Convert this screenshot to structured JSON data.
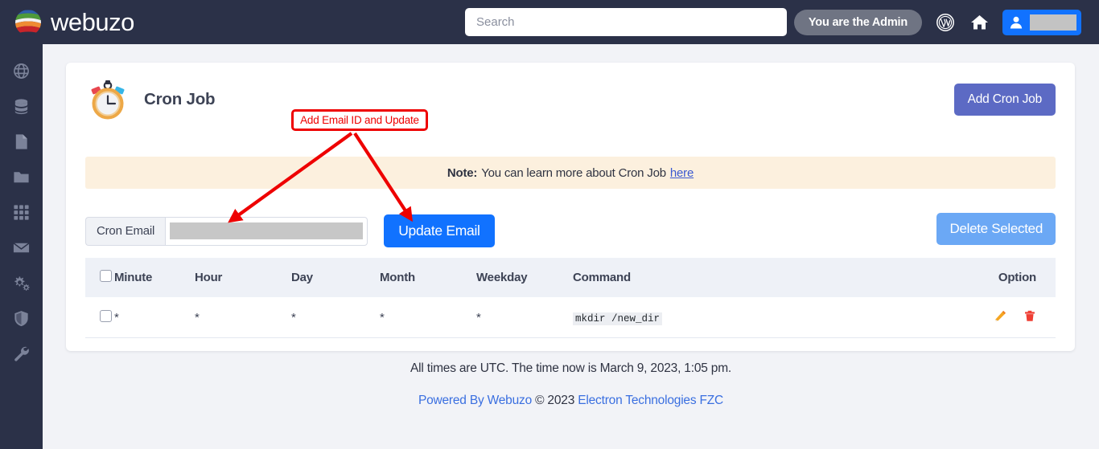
{
  "header": {
    "brand": "webuzo",
    "search_placeholder": "Search",
    "admin_badge": "You are the Admin",
    "icons": {
      "wordpress": "wordpress-icon",
      "home": "home-icon",
      "user": "user-icon"
    }
  },
  "sidebar": {
    "items": [
      {
        "icon": "globe-icon",
        "name": "sidebar-item-globe"
      },
      {
        "icon": "database-icon",
        "name": "sidebar-item-database"
      },
      {
        "icon": "file-icon",
        "name": "sidebar-item-file"
      },
      {
        "icon": "folder-icon",
        "name": "sidebar-item-folder"
      },
      {
        "icon": "apps-grid-icon",
        "name": "sidebar-item-apps"
      },
      {
        "icon": "envelope-icon",
        "name": "sidebar-item-mail"
      },
      {
        "icon": "gears-icon",
        "name": "sidebar-item-settings"
      },
      {
        "icon": "shield-icon",
        "name": "sidebar-item-security"
      },
      {
        "icon": "wrench-icon",
        "name": "sidebar-item-tools"
      }
    ]
  },
  "page": {
    "title": "Cron Job",
    "title_icon": "stopwatch-icon",
    "add_button": "Add Cron Job",
    "note": {
      "label": "Note:",
      "text": "You can learn more about Cron Job",
      "link": "here"
    },
    "email_form": {
      "addon_label": "Cron Email",
      "value": "",
      "placeholder": "",
      "update_button": "Update Email"
    },
    "delete_button": "Delete Selected"
  },
  "table": {
    "columns": [
      "",
      "Minute",
      "Hour",
      "Day",
      "Month",
      "Weekday",
      "Command",
      "Option"
    ],
    "rows": [
      {
        "minute": "*",
        "hour": "*",
        "day": "*",
        "month": "*",
        "weekday": "*",
        "command": "mkdir /new_dir",
        "edit_icon": "pencil-icon",
        "delete_icon": "trash-icon"
      }
    ]
  },
  "footer": {
    "time_notice": "All times are UTC. The time now is March 9, 2023, 1:05 pm.",
    "powered_by": "Powered By Webuzo",
    "copyright": "© 2023",
    "company": "Electron Technologies FZC"
  },
  "annotation": {
    "callout_text": "Add Email ID and Update",
    "color": "#ee0000"
  },
  "colors": {
    "topbar": "#2b3148",
    "sidebar": "#2b3148",
    "page_bg": "#f2f3f7",
    "primary_blue": "#1172ff",
    "indigo": "#5c6ac4",
    "light_blue": "#6ba8f5",
    "note_bg": "#fcf0de",
    "link": "#3a6fe0",
    "annotation_red": "#ee0000"
  }
}
